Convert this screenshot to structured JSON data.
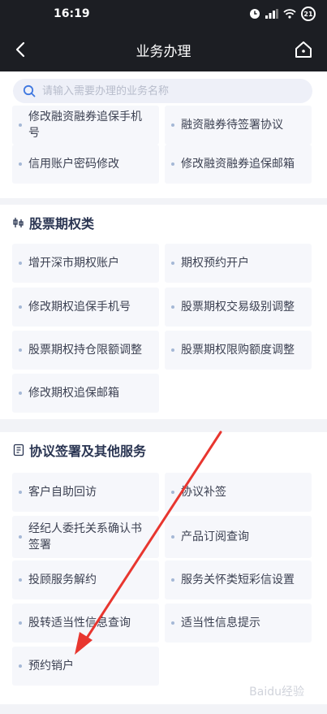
{
  "status_bar": {
    "time": "16:19",
    "battery": "21"
  },
  "nav": {
    "title": "业务办理"
  },
  "search": {
    "placeholder": "请输入需要办理的业务名称"
  },
  "section_margin": {
    "items": [
      "修改融资融券追保手机号",
      "融资融券待签署协议",
      "信用账户密码修改",
      "修改融资融券追保邮箱"
    ]
  },
  "section_options": {
    "title": "股票期权类",
    "items": [
      "增开深市期权账户",
      "期权预约开户",
      "修改期权追保手机号",
      "股票期权交易级别调整",
      "股票期权持仓限额调整",
      "股票期权限购额度调整",
      "修改期权追保邮箱"
    ]
  },
  "section_agreements": {
    "title": "协议签署及其他服务",
    "items": [
      "客户自助回访",
      "协议补签",
      "经纪人委托关系确认书签署",
      "产品订阅查询",
      "投顾服务解约",
      "服务关怀类短彩信设置",
      "股转适当性信息查询",
      "适当性信息提示",
      "预约销户"
    ]
  },
  "watermark": "Baidu经验",
  "colors": {
    "header_bg": "#1c1e23",
    "accent_arrow": "#e8362f",
    "section_title": "#2a3552"
  },
  "icons": [
    "back-icon",
    "home-icon",
    "search-icon",
    "options-section-icon",
    "agreement-section-icon"
  ]
}
